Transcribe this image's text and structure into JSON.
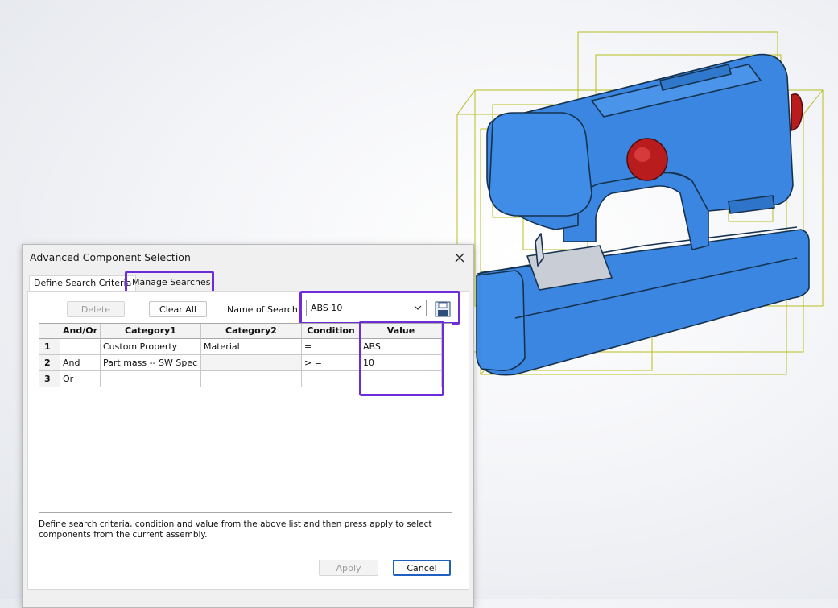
{
  "dialog": {
    "title": "Advanced Component Selection",
    "tabs": {
      "define": "Define Search Criteria",
      "manage": "Manage Searches"
    },
    "toolbar": {
      "delete_label": "Delete",
      "clear_all_label": "Clear All",
      "name_of_search_label": "Name of Search:",
      "name_of_search_value": "ABS 10"
    },
    "grid": {
      "headers": [
        "And/Or",
        "Category1",
        "Category2",
        "Condition",
        "Value"
      ],
      "rows": [
        {
          "num": "1",
          "andor": "",
          "cat1": "Custom Property",
          "cat2": "Material",
          "cond": "=",
          "value": "ABS"
        },
        {
          "num": "2",
          "andor": "And",
          "cat1": "Part mass -- SW Spec",
          "cat2": "",
          "cond": "> =",
          "value": "10"
        },
        {
          "num": "3",
          "andor": "Or",
          "cat1": "",
          "cat2": "",
          "cond": "",
          "value": ""
        }
      ]
    },
    "description": "Define search criteria, condition and value from the above list and then press apply to select components from the current assembly.",
    "buttons": {
      "apply": "Apply",
      "cancel": "Cancel"
    }
  },
  "colors": {
    "highlight": "#6e2bd9",
    "model_body": "#3a86e0",
    "model_knob": "#b81c1c",
    "bounding_box": "#b8be1e"
  },
  "icons": [
    "close-icon",
    "dropdown-arrow-icon",
    "save-icon"
  ]
}
